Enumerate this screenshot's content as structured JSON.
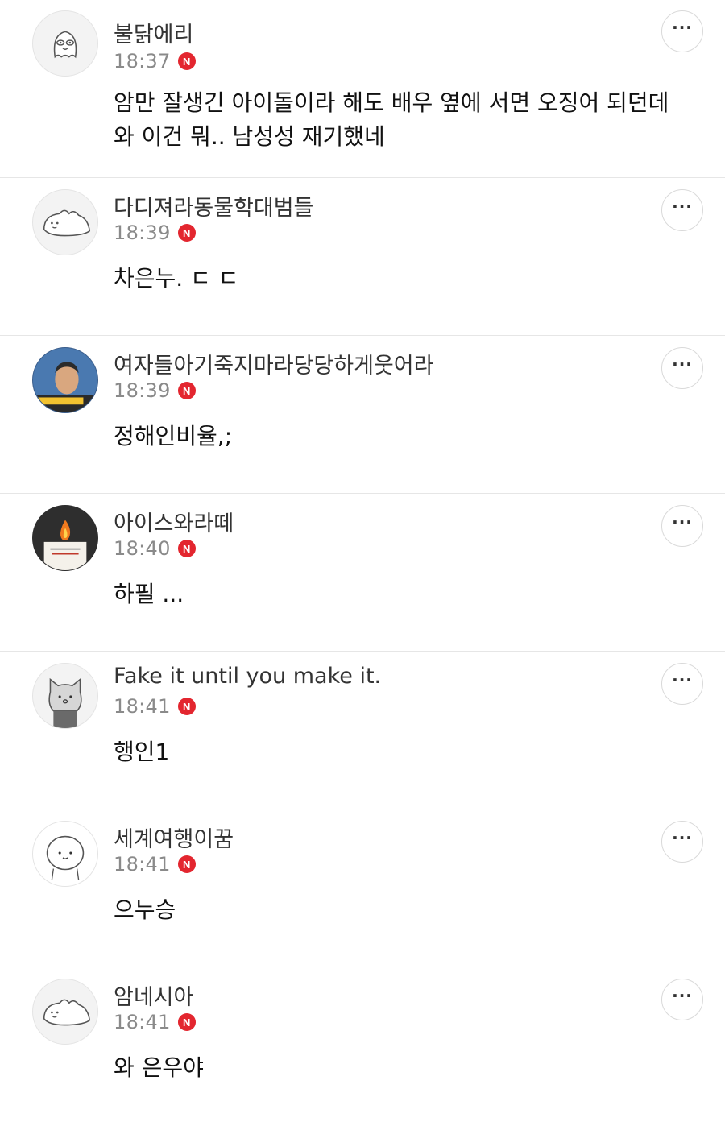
{
  "comments": [
    {
      "nickname": "불닭에리",
      "time": "18:37",
      "badge": "N",
      "text": "암만 잘생긴 아이돌이라 해도 배우 옆에 서면 오징어 되던데\n와 이건 뭐.. 남성성 재기했네",
      "more": "···",
      "avatar_icon": "ghost-character-icon"
    },
    {
      "nickname": "다디져라동물학대범들",
      "time": "18:39",
      "badge": "N",
      "text": "차은누. ㄷ ㄷ",
      "more": "···",
      "avatar_icon": "dinosaur-character-icon"
    },
    {
      "nickname": "여자들아기죽지마라당당하게웃어라",
      "time": "18:39",
      "badge": "N",
      "text": "정해인비율,;",
      "more": "···",
      "avatar_icon": "person-photo-icon"
    },
    {
      "nickname": "아이스와라떼",
      "time": "18:40",
      "badge": "N",
      "text": "하필 ...",
      "more": "···",
      "avatar_icon": "candle-photo-icon"
    },
    {
      "nickname": "Fake it until you make it.",
      "time": "18:41",
      "badge": "N",
      "text": "행인1",
      "more": "···",
      "avatar_icon": "cat-character-icon"
    },
    {
      "nickname": "세계여행이꿈",
      "time": "18:41",
      "badge": "N",
      "text": "으누승",
      "more": "···",
      "avatar_icon": "round-character-icon"
    },
    {
      "nickname": "암네시아",
      "time": "18:41",
      "badge": "N",
      "text": "와 은우야",
      "more": "···",
      "avatar_icon": "dinosaur-character-icon"
    }
  ]
}
